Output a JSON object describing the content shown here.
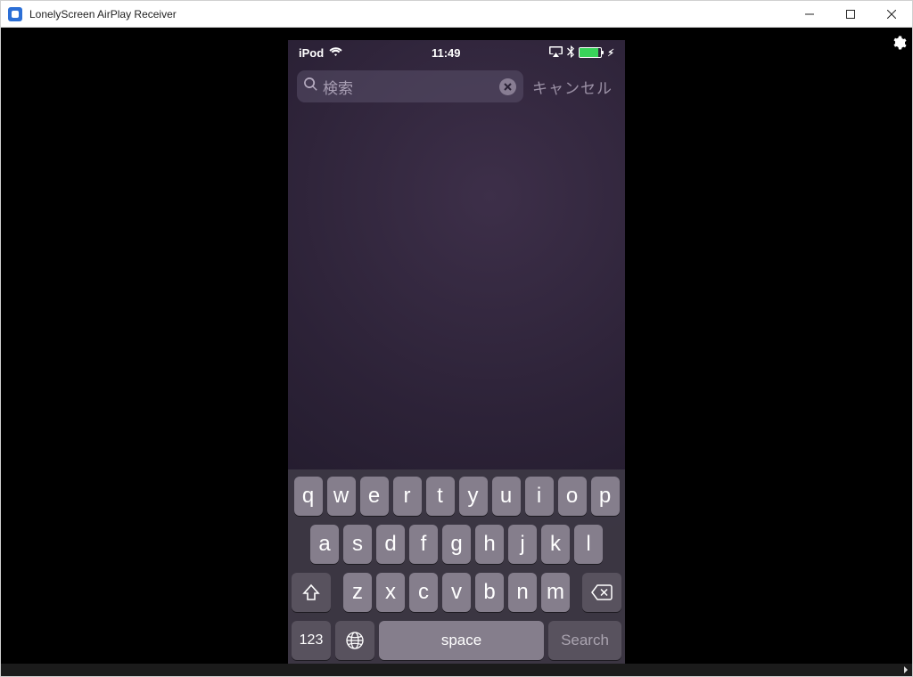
{
  "window": {
    "title": "LonelyScreen AirPlay Receiver"
  },
  "statusbar": {
    "device": "iPod",
    "time": "11:49"
  },
  "search": {
    "placeholder": "検索",
    "cancel": "キャンセル"
  },
  "keyboard": {
    "row1": [
      "q",
      "w",
      "e",
      "r",
      "t",
      "y",
      "u",
      "i",
      "o",
      "p"
    ],
    "row2": [
      "a",
      "s",
      "d",
      "f",
      "g",
      "h",
      "j",
      "k",
      "l"
    ],
    "row3": [
      "z",
      "x",
      "c",
      "v",
      "b",
      "n",
      "m"
    ],
    "numkey": "123",
    "space": "space",
    "search": "Search"
  }
}
